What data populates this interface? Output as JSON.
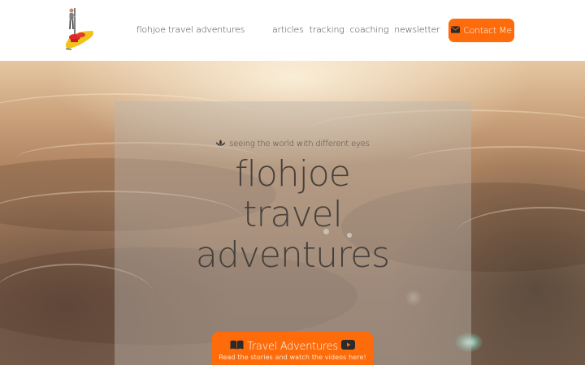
{
  "header": {
    "brand": "flohjoe travel adventures",
    "nav": [
      {
        "label": "articles"
      },
      {
        "label": "tracking"
      },
      {
        "label": "coaching"
      },
      {
        "label": "newsletter"
      }
    ],
    "contact": {
      "label": "Contact Me",
      "icon": "envelope-icon"
    }
  },
  "hero": {
    "tagline": "seeing the world with different eyes",
    "tagline_icon": "lotus-icon",
    "title_lines": [
      "flohjoe",
      "travel",
      "adventures"
    ],
    "cta": {
      "label": "Travel Adventures",
      "subtitle": "Read the stories and watch the videos here!",
      "left_icon": "book-icon",
      "right_icon": "youtube-icon"
    }
  },
  "colors": {
    "accent": "#fe6b0b",
    "text": "#444444",
    "title": "#46403c"
  }
}
